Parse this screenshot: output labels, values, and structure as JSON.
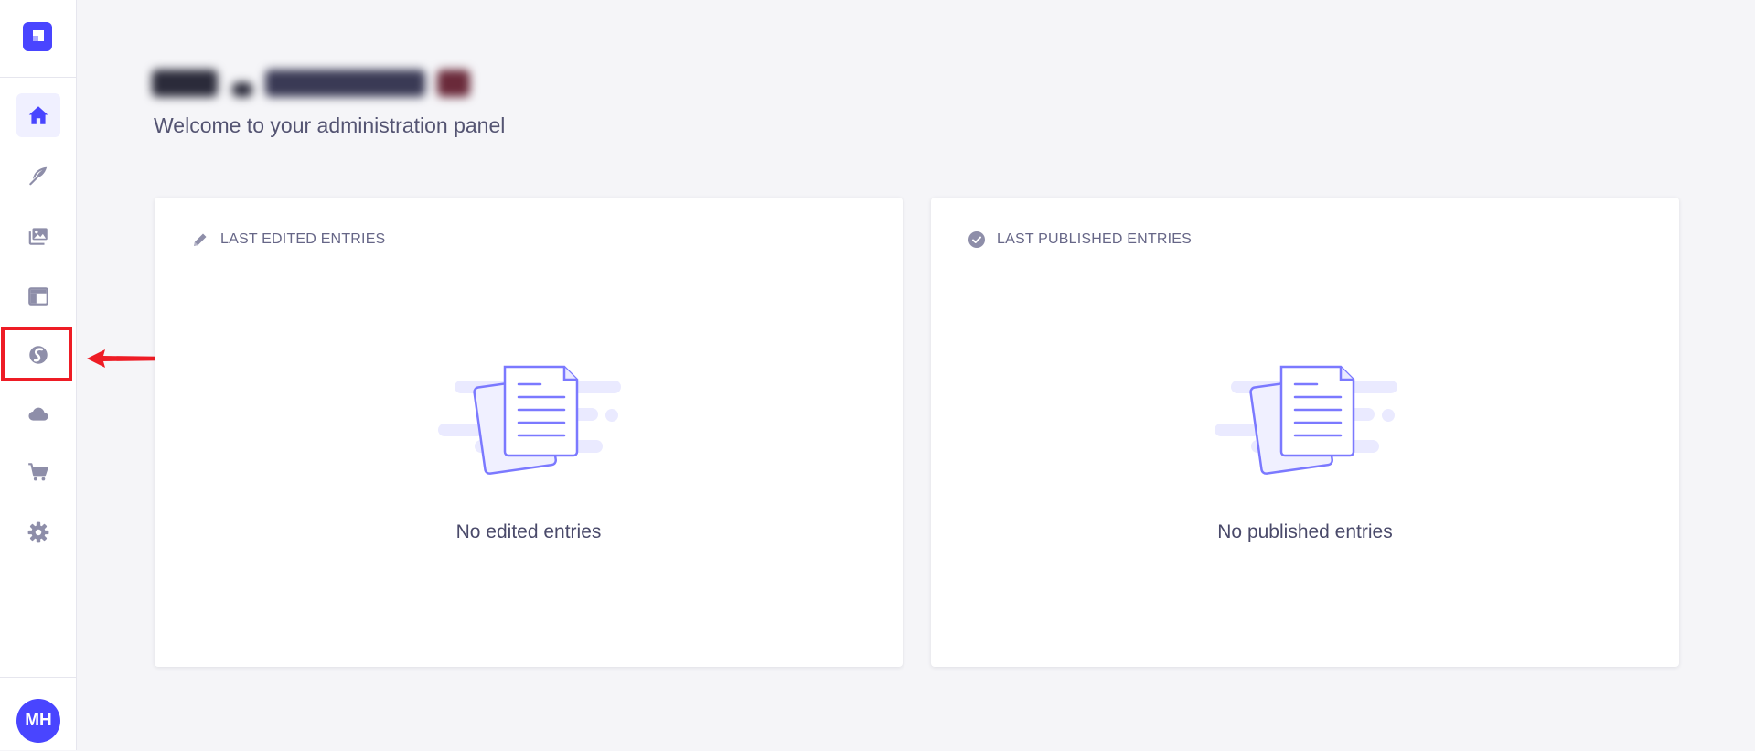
{
  "sidebar": {
    "items": [
      {
        "id": "home",
        "icon": "house-icon",
        "active": true
      },
      {
        "id": "content-manager",
        "icon": "feather-icon",
        "active": false
      },
      {
        "id": "media-library",
        "icon": "images-icon",
        "active": false
      },
      {
        "id": "content-type-builder",
        "icon": "layout-icon",
        "active": false
      },
      {
        "id": "plugin",
        "icon": "s-logo-icon",
        "active": false
      },
      {
        "id": "cloud",
        "icon": "cloud-icon",
        "active": false
      },
      {
        "id": "marketplace",
        "icon": "cart-icon",
        "active": false
      },
      {
        "id": "settings",
        "icon": "gear-icon",
        "active": false
      }
    ],
    "user_initials": "MH"
  },
  "header": {
    "subtitle": "Welcome to your administration panel"
  },
  "cards": {
    "last_edited": {
      "title": "LAST EDITED ENTRIES",
      "empty_text": "No edited entries"
    },
    "last_published": {
      "title": "LAST PUBLISHED ENTRIES",
      "empty_text": "No published entries"
    }
  },
  "colors": {
    "accent": "#4945ff",
    "annotation": "#ee1c25"
  }
}
